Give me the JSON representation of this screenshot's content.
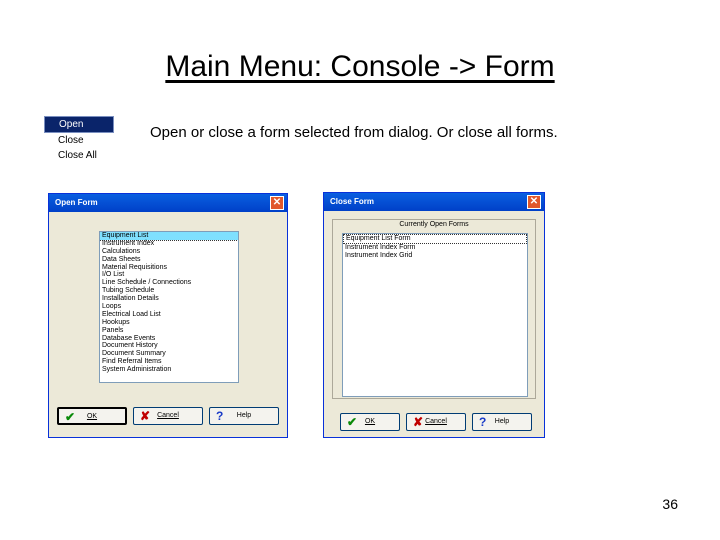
{
  "slide": {
    "title": "Main Menu:  Console -> Form",
    "description": "Open or close a form selected from dialog.  Or close all forms.",
    "page_number": "36"
  },
  "menu": {
    "items": [
      {
        "label": "Open",
        "selected": true
      },
      {
        "label": "Close",
        "selected": false
      },
      {
        "label": "Close All",
        "selected": false
      }
    ]
  },
  "open_form_dialog": {
    "title": "Open Form",
    "close_glyph": "✕",
    "items": [
      "Equipment List",
      "Instrument Index",
      "Calculations",
      "Data Sheets",
      "Material Requisitions",
      "I/O List",
      "Line Schedule / Connections",
      "Tubing Schedule",
      "Installation Details",
      "Loops",
      "Electrical Load List",
      "Hookups",
      "Panels",
      "Database Events",
      "Document History",
      "Document Summary",
      "Find Referral Items",
      "System Administration"
    ],
    "buttons": {
      "ok": "OK",
      "cancel": "Cancel",
      "help": "Help"
    }
  },
  "close_form_dialog": {
    "title": "Close Form",
    "group_label": "Currently Open Forms",
    "close_glyph": "✕",
    "items": [
      "Equipment List Form",
      "Instrument Index Form",
      "Instrument Index Grid"
    ],
    "buttons": {
      "ok": "OK",
      "cancel": "Cancel",
      "help": "Help"
    }
  },
  "icons": {
    "check": "✔",
    "x": "✘",
    "help": "?"
  },
  "colors": {
    "titlebar": "#0a5fe0",
    "dialog_bg": "#ece9d8",
    "menu_highlight": "#0a246a",
    "list_highlight": "#7fe0ff"
  }
}
